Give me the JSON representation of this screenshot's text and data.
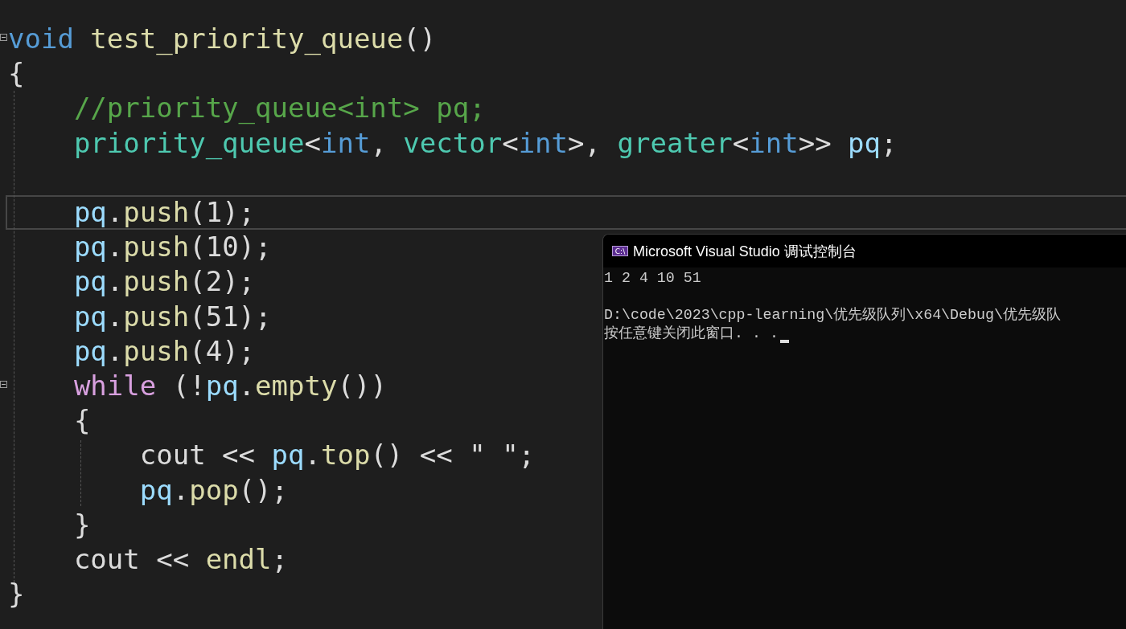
{
  "editor": {
    "lines": [
      {
        "kind": "code",
        "fold": true,
        "current": false,
        "tokens": [
          {
            "t": "void ",
            "color": "#569cd6"
          },
          {
            "t": "test_priority_queue",
            "color": "#dcdcaa"
          },
          {
            "t": "()",
            "color": "#dcdcdc"
          }
        ]
      },
      {
        "kind": "code",
        "fold": false,
        "current": false,
        "tokens": [
          {
            "t": "{",
            "color": "#dcdcdc"
          }
        ]
      },
      {
        "kind": "code",
        "fold": false,
        "current": false,
        "tokens": [
          {
            "t": "    //priority_queue<int> pq;",
            "color": "#57a64a"
          }
        ]
      },
      {
        "kind": "code",
        "fold": false,
        "current": false,
        "tokens": [
          {
            "t": "    priority_queue",
            "color": "#4ec9b0"
          },
          {
            "t": "<",
            "color": "#dcdcdc"
          },
          {
            "t": "int",
            "color": "#569cd6"
          },
          {
            "t": ", ",
            "color": "#dcdcdc"
          },
          {
            "t": "vector",
            "color": "#4ec9b0"
          },
          {
            "t": "<",
            "color": "#dcdcdc"
          },
          {
            "t": "int",
            "color": "#569cd6"
          },
          {
            "t": ">, ",
            "color": "#dcdcdc"
          },
          {
            "t": "greater",
            "color": "#4ec9b0"
          },
          {
            "t": "<",
            "color": "#dcdcdc"
          },
          {
            "t": "int",
            "color": "#569cd6"
          },
          {
            "t": ">> ",
            "color": "#dcdcdc"
          },
          {
            "t": "pq",
            "color": "#9cdcfe"
          },
          {
            "t": ";",
            "color": "#dcdcdc"
          }
        ]
      },
      {
        "kind": "blank",
        "fold": false,
        "current": false
      },
      {
        "kind": "code",
        "fold": false,
        "current": true,
        "tokens": [
          {
            "t": "    pq",
            "color": "#9cdcfe"
          },
          {
            "t": ".",
            "color": "#dcdcdc"
          },
          {
            "t": "push",
            "color": "#dcdcaa"
          },
          {
            "t": "(1);",
            "color": "#dcdcdc"
          }
        ]
      },
      {
        "kind": "code",
        "fold": false,
        "current": false,
        "tokens": [
          {
            "t": "    pq",
            "color": "#9cdcfe"
          },
          {
            "t": ".",
            "color": "#dcdcdc"
          },
          {
            "t": "push",
            "color": "#dcdcaa"
          },
          {
            "t": "(10);",
            "color": "#dcdcdc"
          }
        ]
      },
      {
        "kind": "code",
        "fold": false,
        "current": false,
        "tokens": [
          {
            "t": "    pq",
            "color": "#9cdcfe"
          },
          {
            "t": ".",
            "color": "#dcdcdc"
          },
          {
            "t": "push",
            "color": "#dcdcaa"
          },
          {
            "t": "(2);",
            "color": "#dcdcdc"
          }
        ]
      },
      {
        "kind": "code",
        "fold": false,
        "current": false,
        "tokens": [
          {
            "t": "    pq",
            "color": "#9cdcfe"
          },
          {
            "t": ".",
            "color": "#dcdcdc"
          },
          {
            "t": "push",
            "color": "#dcdcaa"
          },
          {
            "t": "(51);",
            "color": "#dcdcdc"
          }
        ]
      },
      {
        "kind": "code",
        "fold": false,
        "current": false,
        "tokens": [
          {
            "t": "    pq",
            "color": "#9cdcfe"
          },
          {
            "t": ".",
            "color": "#dcdcdc"
          },
          {
            "t": "push",
            "color": "#dcdcaa"
          },
          {
            "t": "(4);",
            "color": "#dcdcdc"
          }
        ]
      },
      {
        "kind": "code",
        "fold": true,
        "current": false,
        "tokens": [
          {
            "t": "    while",
            "color": "#d8a0df"
          },
          {
            "t": " (!",
            "color": "#dcdcdc"
          },
          {
            "t": "pq",
            "color": "#9cdcfe"
          },
          {
            "t": ".",
            "color": "#dcdcdc"
          },
          {
            "t": "empty",
            "color": "#dcdcaa"
          },
          {
            "t": "())",
            "color": "#dcdcdc"
          }
        ]
      },
      {
        "kind": "code",
        "fold": false,
        "current": false,
        "tokens": [
          {
            "t": "    {",
            "color": "#dcdcdc"
          }
        ]
      },
      {
        "kind": "code",
        "fold": false,
        "current": false,
        "tokens": [
          {
            "t": "        cout << ",
            "color": "#dcdcdc"
          },
          {
            "t": "pq",
            "color": "#9cdcfe"
          },
          {
            "t": ".",
            "color": "#dcdcdc"
          },
          {
            "t": "top",
            "color": "#dcdcaa"
          },
          {
            "t": "() << \" \";",
            "color": "#dcdcdc"
          }
        ]
      },
      {
        "kind": "code",
        "fold": false,
        "current": false,
        "tokens": [
          {
            "t": "        pq",
            "color": "#9cdcfe"
          },
          {
            "t": ".",
            "color": "#dcdcdc"
          },
          {
            "t": "pop",
            "color": "#dcdcaa"
          },
          {
            "t": "();",
            "color": "#dcdcdc"
          }
        ]
      },
      {
        "kind": "code",
        "fold": false,
        "current": false,
        "tokens": [
          {
            "t": "    }",
            "color": "#dcdcdc"
          }
        ]
      },
      {
        "kind": "code",
        "fold": false,
        "current": false,
        "tokens": [
          {
            "t": "    cout << ",
            "color": "#dcdcdc"
          },
          {
            "t": "endl",
            "color": "#dcdcaa"
          },
          {
            "t": ";",
            "color": "#dcdcdc"
          }
        ]
      },
      {
        "kind": "code",
        "fold": false,
        "current": false,
        "tokens": [
          {
            "t": "}",
            "color": "#dcdcdc"
          }
        ]
      }
    ]
  },
  "console": {
    "icon_text": "C:\\",
    "title": "Microsoft Visual Studio 调试控制台",
    "output": "1 2 4 10 51",
    "path": "D:\\code\\2023\\cpp-learning\\优先级队列\\x64\\Debug\\优先级队",
    "prompt": "按任意键关闭此窗口. . ."
  }
}
